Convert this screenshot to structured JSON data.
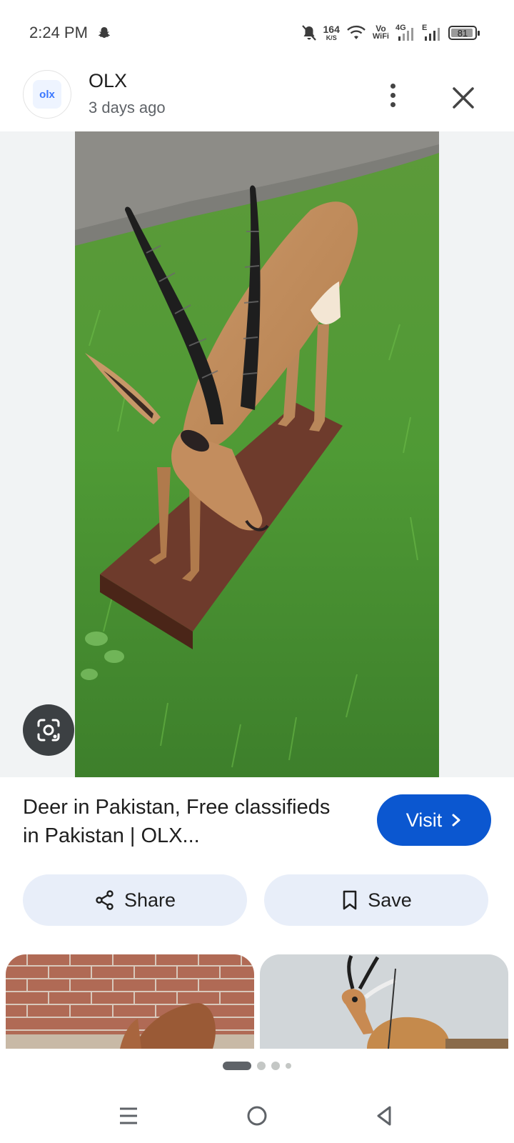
{
  "status_bar": {
    "time": "2:24 PM",
    "net_speed_value": "164",
    "net_speed_unit": "K/S",
    "vowifi_top": "Vo",
    "vowifi_bottom": "WiFi",
    "network_4g": "4G",
    "network_e": "E",
    "battery": "81",
    "icons": [
      "snapchat-icon",
      "mute-bell-icon",
      "wifi-icon",
      "signal-icon",
      "battery-icon"
    ]
  },
  "header": {
    "source_logo_text": "olx",
    "source_name": "OLX",
    "time_ago": "3 days ago",
    "icons": [
      "more-vert-icon",
      "close-icon"
    ]
  },
  "result": {
    "title": "Deer in Pakistan, Free classifieds in Pakistan | OLX...",
    "visit_label": "Visit",
    "visit_color": "#0b57d0"
  },
  "actions": {
    "share_label": "Share",
    "save_label": "Save",
    "button_bg": "#e8eef9"
  },
  "pager": {
    "active_index": 0,
    "count": 4
  },
  "nav": {
    "icons": [
      "menu-icon",
      "home-circle-icon",
      "back-triangle-icon"
    ]
  }
}
